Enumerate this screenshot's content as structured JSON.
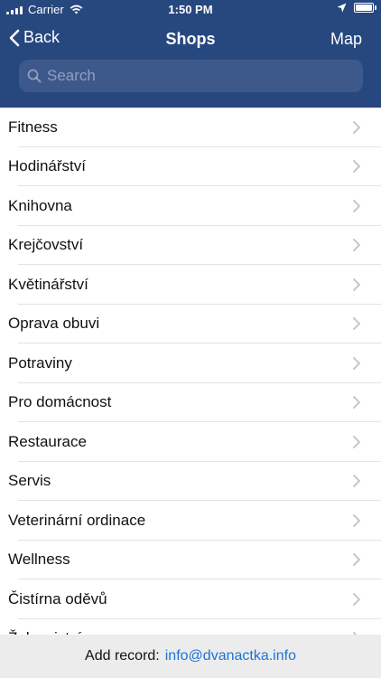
{
  "status_bar": {
    "carrier": "Carrier",
    "time": "1:50 PM"
  },
  "nav": {
    "back_label": "Back",
    "title": "Shops",
    "map_label": "Map"
  },
  "search": {
    "placeholder": "Search",
    "value": ""
  },
  "categories": [
    "Fitness",
    "Hodinářství",
    "Knihovna",
    "Krejčovství",
    "Květinářství",
    "Oprava obuvi",
    "Potraviny",
    "Pro domácnost",
    "Restaurace",
    "Servis",
    "Veterinární ordinace",
    "Wellness",
    "Čistírna oděvů",
    "Železnictví"
  ],
  "footer": {
    "label": "Add record:",
    "email": "info@dvanactka.info"
  },
  "colors": {
    "header_bg": "#27477f",
    "link": "#1d73d6",
    "separator": "#e3e3e8",
    "chevron": "#c7c7cc"
  },
  "icons": {
    "back": "chevron-left-icon",
    "search": "magnifier-icon",
    "row": "chevron-right-icon",
    "wifi": "wifi-icon",
    "location": "location-arrow-icon",
    "battery": "battery-icon",
    "signal": "signal-bars-icon"
  }
}
